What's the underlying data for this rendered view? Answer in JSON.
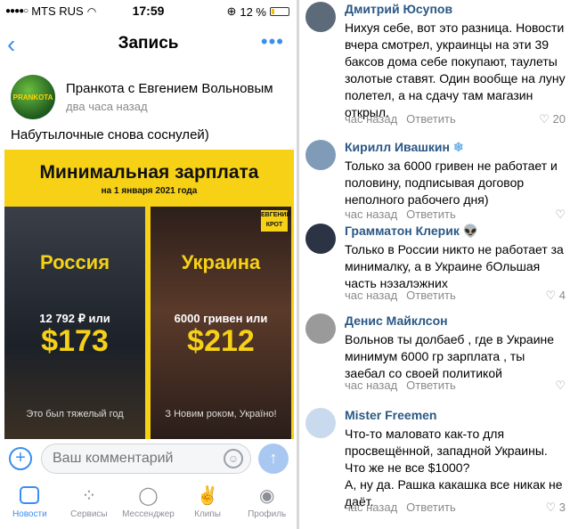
{
  "status": {
    "carrier": "MTS RUS",
    "time": "17:59",
    "battery": "12 %"
  },
  "nav": {
    "title": "Запись",
    "back_icon": "chevron-left-icon",
    "more_icon": "more-icon"
  },
  "post": {
    "author": "Пранкота с Евгением Вольновым",
    "avatar_text": "PRANKOTA",
    "time": "два часа назад",
    "text": "Набутылочные снова соснулей)",
    "image": {
      "title": "Минимальная зарплата",
      "subtitle": "на 1 января 2021 года",
      "left": {
        "country": "Россия",
        "local": "12 792 ₽ или",
        "usd": "$173",
        "caption": "Это был тяжелый год"
      },
      "right": {
        "country": "Украина",
        "local": "6000 гривен или",
        "usd": "$212",
        "caption": "З Новим роком, Україно!",
        "badge": "ЕВГЕНИЙ КРОТ"
      }
    }
  },
  "comment_input": {
    "placeholder": "Ваш комментарий"
  },
  "tabs": [
    {
      "label": "Новости",
      "icon": "news-icon",
      "active": true
    },
    {
      "label": "Сервисы",
      "icon": "services-icon",
      "active": false
    },
    {
      "label": "Мессенджер",
      "icon": "messenger-icon",
      "active": false
    },
    {
      "label": "Клипы",
      "icon": "clips-icon",
      "active": false
    },
    {
      "label": "Профиль",
      "icon": "profile-icon",
      "active": false
    }
  ],
  "comments": [
    {
      "name": "Дмитрий Юсупов",
      "text": "Нихуя себе, вот это разница. Новости вчера смотрел, украинцы на эти 39 баксов дома себе покупают, таулеты золотые ставят. Один вообще на луну полетел, а на сдачу там магазин открыл.",
      "time": "час назад",
      "reply": "Ответить",
      "likes": "20"
    },
    {
      "name": "Кирилл Ивашкин",
      "badge": "❄",
      "text": "Только за 6000 гривен не работает и половину, подписывая договор неполного рабочего дня)",
      "time": "час назад",
      "reply": "Ответить",
      "likes": ""
    },
    {
      "name": "Грамматон Клерик",
      "badge": "👽",
      "text": "Только в России никто не работает за минималку, а в Украине бОльшая часть нэзалэжних",
      "time": "час назад",
      "reply": "Ответить",
      "likes": "4"
    },
    {
      "name": "Денис Майклсон",
      "text": "Вольнов ты долбаеб , где в Украине минимум 6000 гр зарплата , ты заебал со своей политикой",
      "time": "час назад",
      "reply": "Ответить",
      "likes": ""
    },
    {
      "name": "Mister Freemen",
      "text": "Что-то маловато как-то для просвещённой, западной Украины. Что же не все $1000?\nА, ну да. Рашка какашка все никак не даёт.",
      "time": "час назад",
      "reply": "Ответить",
      "likes": "3"
    }
  ],
  "colors": {
    "accent": "#3a8ef0",
    "poster_yellow": "#f6d116",
    "name_blue": "#2a5885"
  }
}
